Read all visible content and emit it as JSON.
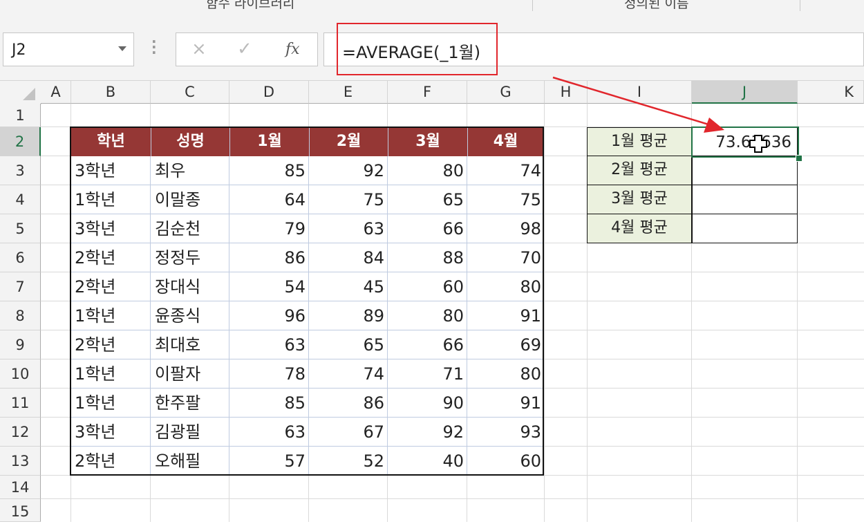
{
  "ribbon": {
    "group_function_library": "함수 라이브러리",
    "group_defined_names": "정의된 이름"
  },
  "formula_bar": {
    "name_box": "J2",
    "cancel_icon": "×",
    "enter_icon": "✓",
    "insert_function": "fx",
    "formula": "=AVERAGE(_1월)"
  },
  "columns": [
    "A",
    "B",
    "C",
    "D",
    "E",
    "F",
    "G",
    "H",
    "I",
    "J",
    "K"
  ],
  "rows": [
    "1",
    "2",
    "3",
    "4",
    "5",
    "6",
    "7",
    "8",
    "9",
    "10",
    "11",
    "12",
    "13",
    "14",
    "15"
  ],
  "selected_column": "J",
  "selected_row": "2",
  "table": {
    "headers": [
      "학년",
      "성명",
      "1월",
      "2월",
      "3월",
      "4월"
    ],
    "rows": [
      [
        "3학년",
        "최우",
        "85",
        "92",
        "80",
        "74"
      ],
      [
        "1학년",
        "이말종",
        "64",
        "75",
        "65",
        "75"
      ],
      [
        "3학년",
        "김순천",
        "79",
        "63",
        "66",
        "98"
      ],
      [
        "2학년",
        "정정두",
        "86",
        "84",
        "88",
        "70"
      ],
      [
        "2학년",
        "장대식",
        "54",
        "45",
        "60",
        "80"
      ],
      [
        "1학년",
        "윤종식",
        "96",
        "89",
        "80",
        "91"
      ],
      [
        "2학년",
        "최대호",
        "63",
        "65",
        "66",
        "69"
      ],
      [
        "1학년",
        "이팔자",
        "78",
        "74",
        "71",
        "80"
      ],
      [
        "1학년",
        "한주팔",
        "85",
        "86",
        "90",
        "91"
      ],
      [
        "3학년",
        "김광필",
        "63",
        "67",
        "92",
        "93"
      ],
      [
        "2학년",
        "오해필",
        "57",
        "52",
        "40",
        "60"
      ]
    ]
  },
  "averages": [
    {
      "label": "1월 평균",
      "value": "73.63636"
    },
    {
      "label": "2월 평균",
      "value": ""
    },
    {
      "label": "3월 평균",
      "value": ""
    },
    {
      "label": "4월 평균",
      "value": ""
    }
  ],
  "colors": {
    "header_fill": "#953735",
    "label_fill": "#ebf1de",
    "selection": "#217346",
    "highlight": "#e1262c"
  }
}
